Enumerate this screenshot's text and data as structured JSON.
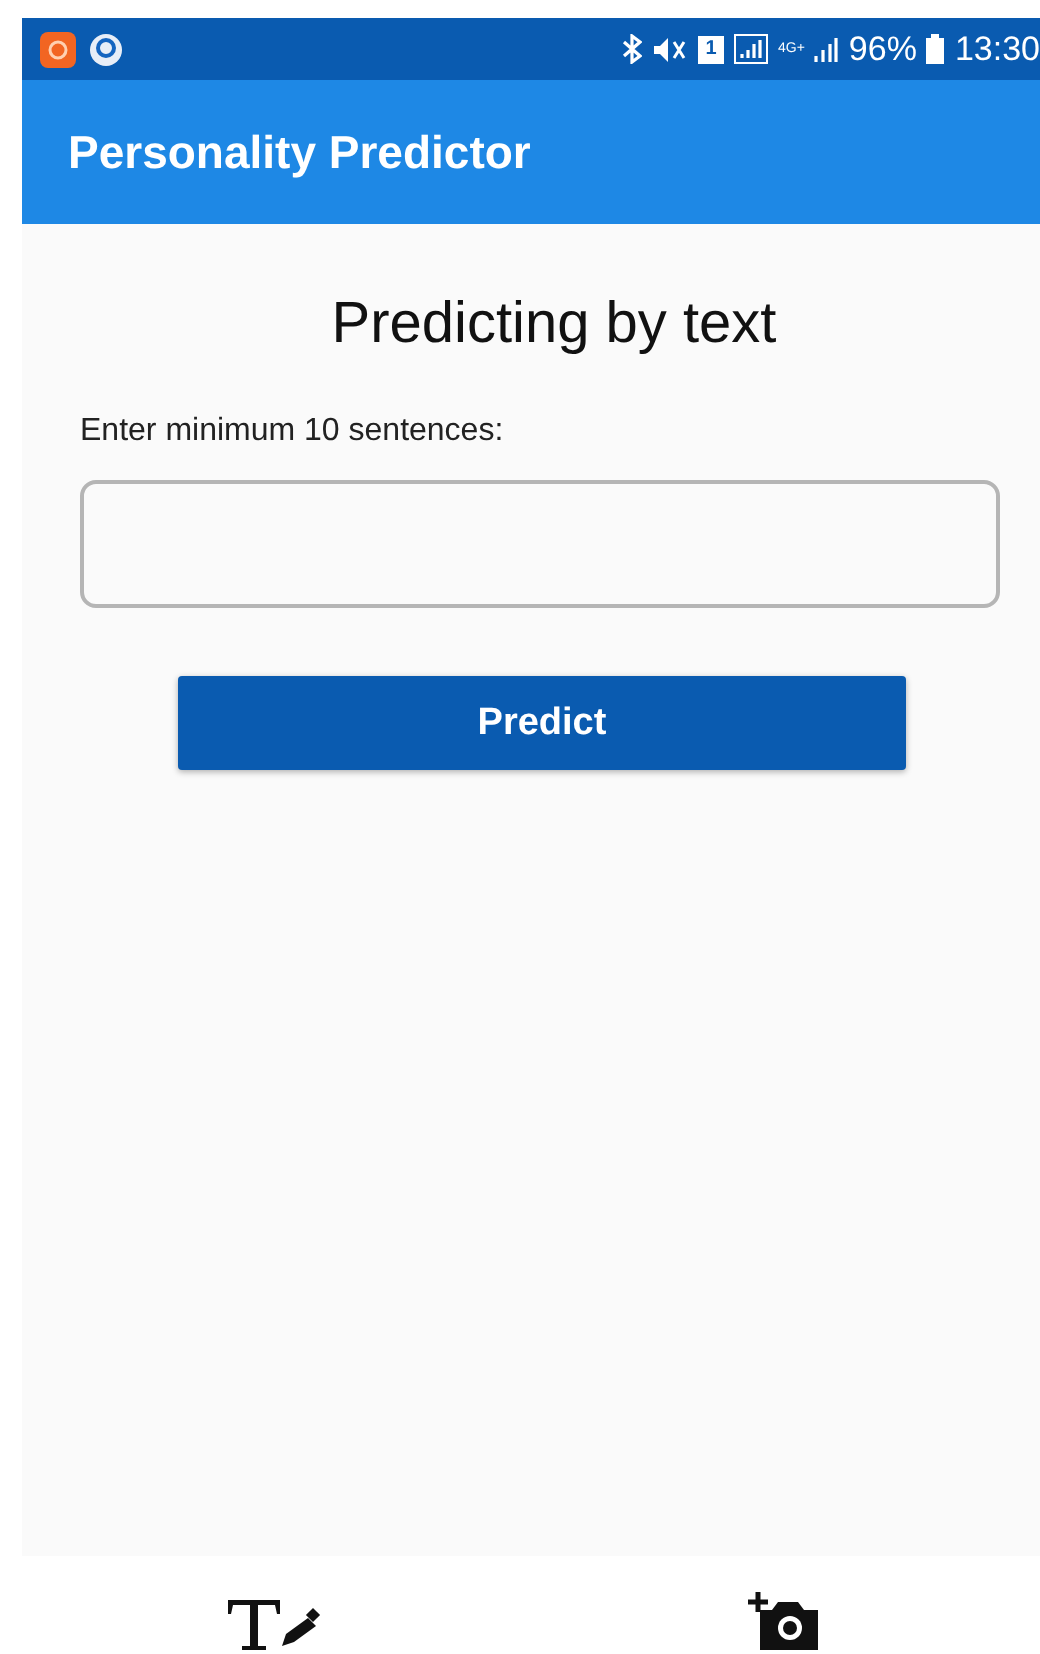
{
  "status_bar": {
    "sim": "1",
    "network": "4G+",
    "battery": "96%",
    "time": "13:30"
  },
  "app_bar": {
    "title": "Personality Predictor"
  },
  "heading": "Predicting by text",
  "input": {
    "label": "Enter minimum 10 sentences:"
  },
  "button": "Predict",
  "bottom_nav": [
    {
      "kind": "text"
    },
    {
      "kind": "camera"
    }
  ]
}
